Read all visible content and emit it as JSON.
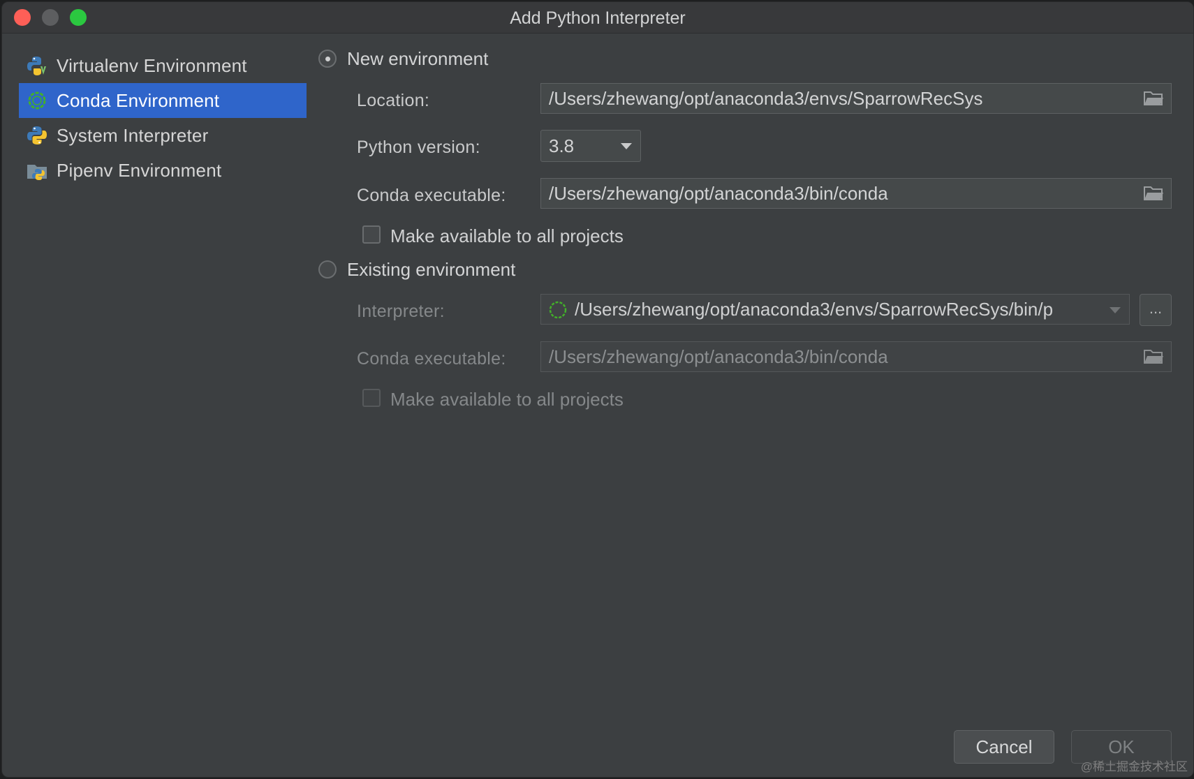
{
  "window": {
    "title": "Add Python Interpreter"
  },
  "sidebar": {
    "items": [
      {
        "label": "Virtualenv Environment",
        "icon": "python-virtualenv-icon",
        "selected": false
      },
      {
        "label": "Conda Environment",
        "icon": "conda-icon",
        "selected": true
      },
      {
        "label": "System Interpreter",
        "icon": "python-icon",
        "selected": false
      },
      {
        "label": "Pipenv Environment",
        "icon": "pipenv-icon",
        "selected": false
      }
    ]
  },
  "new_env": {
    "radio_label": "New environment",
    "selected": true,
    "location_label": "Location:",
    "location_value": "/Users/zhewang/opt/anaconda3/envs/SparrowRecSys",
    "python_version_label": "Python version:",
    "python_version_value": "3.8",
    "conda_exec_label": "Conda executable:",
    "conda_exec_value": "/Users/zhewang/opt/anaconda3/bin/conda",
    "make_available_label": "Make available to all projects",
    "make_available_checked": false
  },
  "existing_env": {
    "radio_label": "Existing environment",
    "selected": false,
    "interpreter_label": "Interpreter:",
    "interpreter_value": "/Users/zhewang/opt/anaconda3/envs/SparrowRecSys/bin/p",
    "browse_label": "...",
    "conda_exec_label": "Conda executable:",
    "conda_exec_value": "/Users/zhewang/opt/anaconda3/bin/conda",
    "make_available_label": "Make available to all projects",
    "make_available_checked": false
  },
  "buttons": {
    "cancel": "Cancel",
    "ok": "OK"
  },
  "watermark": "@稀土掘金技术社区",
  "colors": {
    "selection": "#2f65ca",
    "background": "#3c3f41",
    "conda_green": "#3bb143"
  }
}
